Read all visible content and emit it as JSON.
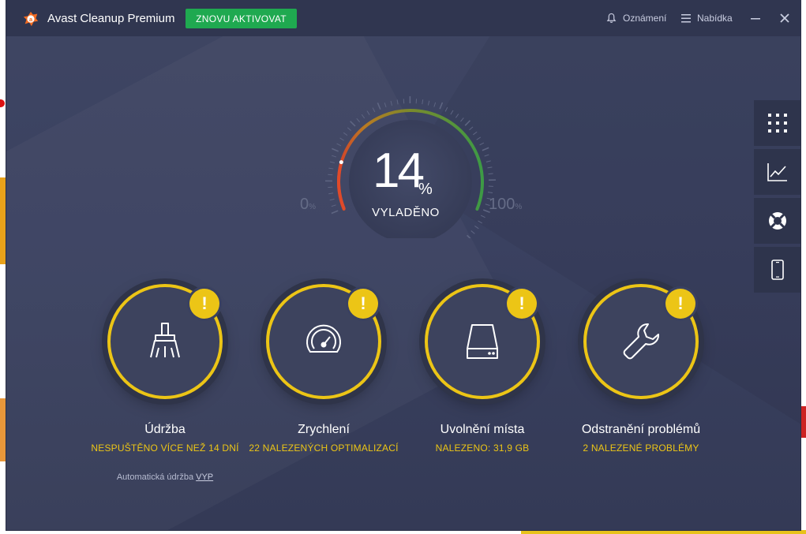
{
  "window": {
    "title": "Avast Cleanup Premium",
    "reactivate_label": "ZNOVU AKTIVOVAT",
    "notifications_label": "Oznámení",
    "menu_label": "Nabídka"
  },
  "gauge": {
    "value": "14",
    "unit": "%",
    "status": "VYLADĚNO",
    "min_label": "0",
    "max_label": "100",
    "percent_sign": "%",
    "fill_fraction": 0.14
  },
  "tiles": [
    {
      "title": "Údržba",
      "status": "NESPUŠTĚNO VÍCE NEŽ 14 DNÍ",
      "sub_text": "Automatická údržba",
      "sub_link": "VYP",
      "icon": "broom-icon",
      "alert": "!"
    },
    {
      "title": "Zrychlení",
      "status": "22 NALEZENÝCH OPTIMALIZACÍ",
      "icon": "speedometer-icon",
      "alert": "!"
    },
    {
      "title": "Uvolnění místa",
      "status": "NALEZENO: 31,9 GB",
      "icon": "hard-drive-icon",
      "alert": "!"
    },
    {
      "title": "Odstranění problémů",
      "status": "2 NALEZENÉ PROBLÉMY",
      "icon": "wrench-icon",
      "alert": "!"
    }
  ],
  "side_panel": {
    "items": [
      "apps-grid-icon",
      "stats-chart-icon",
      "help-lifebuoy-icon",
      "mobile-device-icon"
    ]
  },
  "colors": {
    "accent": "#ecc516",
    "brand": "#f26b21",
    "reactivate": "#1fa950",
    "background": "#3a4160"
  }
}
